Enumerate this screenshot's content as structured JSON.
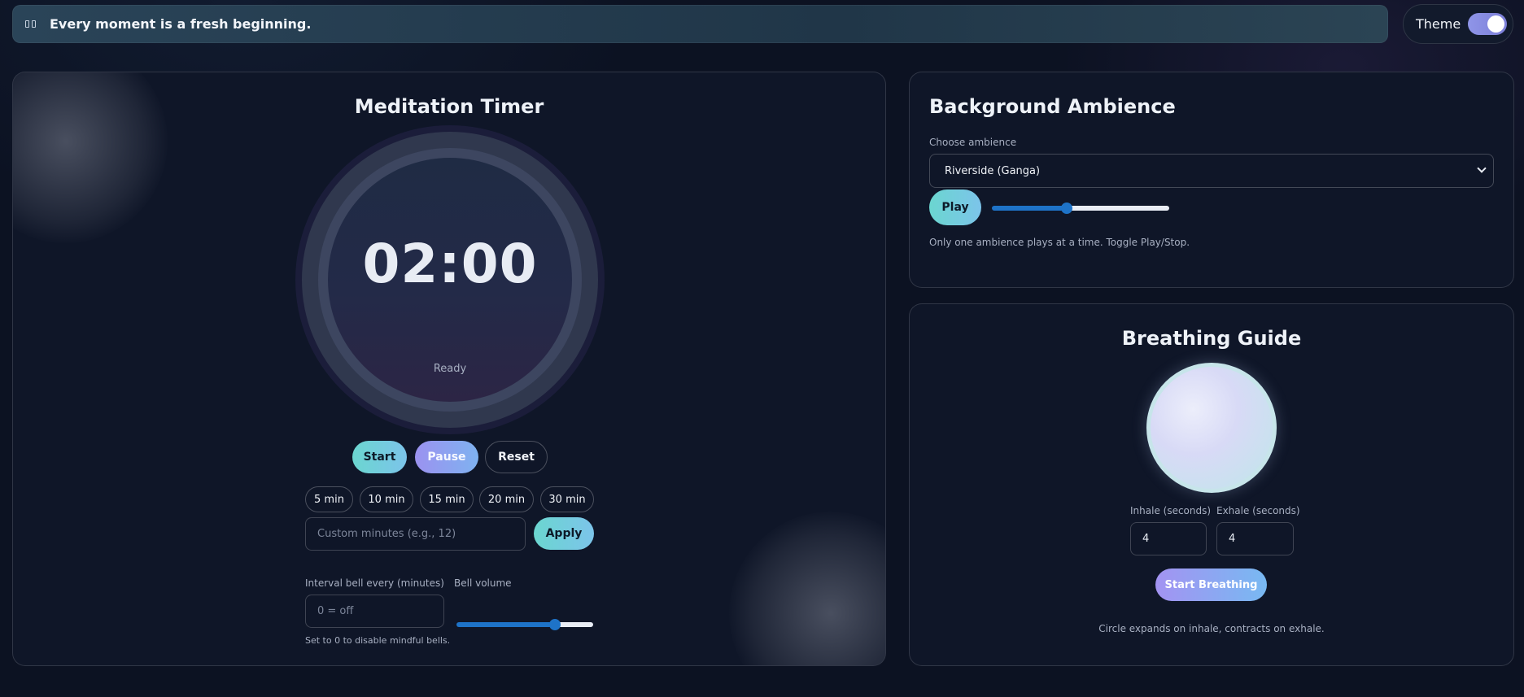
{
  "header": {
    "quote": "Every moment is a fresh beginning.",
    "theme_label": "Theme",
    "theme_on": true
  },
  "timer": {
    "title": "Meditation Timer",
    "time": "02:00",
    "status": "Ready",
    "start_label": "Start",
    "pause_label": "Pause",
    "reset_label": "Reset",
    "presets": [
      "5 min",
      "10 min",
      "15 min",
      "20 min",
      "30 min"
    ],
    "custom_placeholder": "Custom minutes (e.g., 12)",
    "apply_label": "Apply",
    "interval_label": "Interval bell every (minutes)",
    "interval_placeholder": "0 = off",
    "interval_hint": "Set to 0 to disable mindful bells.",
    "bell_volume_label": "Bell volume",
    "bell_volume": 0.72
  },
  "ambience": {
    "title": "Background Ambience",
    "choose_label": "Choose ambience",
    "selected": "Riverside (Ganga)",
    "play_label": "Play",
    "volume": 0.42,
    "note": "Only one ambience plays at a time. Toggle Play/Stop."
  },
  "breathing": {
    "title": "Breathing Guide",
    "inhale_label": "Inhale (seconds)",
    "exhale_label": "Exhale (seconds)",
    "inhale_value": "4",
    "exhale_value": "4",
    "start_label": "Start Breathing",
    "note": "Circle expands on inhale, contracts on exhale."
  },
  "colors": {
    "accent_teal": "#6bd6d0",
    "accent_violet": "#9b92f0",
    "slider_blue": "#1e73c8"
  }
}
